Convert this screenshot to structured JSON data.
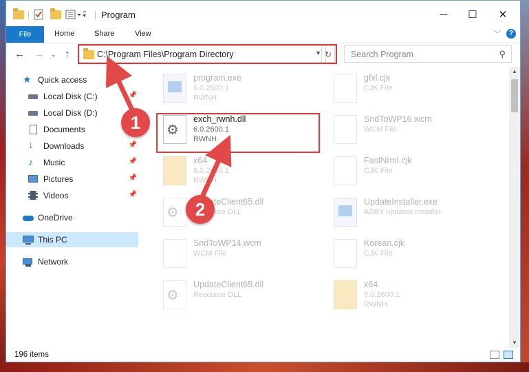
{
  "window": {
    "title": "Program",
    "controls": {
      "minimize": "─",
      "maximize": "☐",
      "close": "✕"
    }
  },
  "ribbon": {
    "file_tab": "File",
    "tabs": [
      "Home",
      "Share",
      "View"
    ],
    "help": "?"
  },
  "address_bar": {
    "path": "C:\\Program Files\\Program Directory",
    "search_placeholder": "Search Program"
  },
  "sidebar": {
    "items": [
      {
        "label": "Quick access",
        "icon": "star-icon",
        "pinned": false
      },
      {
        "label": "Local Disk (C:)",
        "icon": "drive-icon",
        "pinned": true
      },
      {
        "label": "Local Disk (D:)",
        "icon": "drive-icon",
        "pinned": true
      },
      {
        "label": "Documents",
        "icon": "documents-icon",
        "pinned": true
      },
      {
        "label": "Downloads",
        "icon": "download-icon",
        "pinned": true
      },
      {
        "label": "Music",
        "icon": "music-icon",
        "pinned": true
      },
      {
        "label": "Pictures",
        "icon": "pictures-icon",
        "pinned": true
      },
      {
        "label": "Videos",
        "icon": "videos-icon",
        "pinned": true
      },
      {
        "label": "OneDrive",
        "icon": "cloud-icon",
        "pinned": false
      },
      {
        "label": "This PC",
        "icon": "computer-icon",
        "pinned": false,
        "selected": true
      },
      {
        "label": "Network",
        "icon": "network-icon",
        "pinned": false
      }
    ]
  },
  "files": [
    {
      "name": "program.exe",
      "line1": "6.0.2600.1",
      "line2": "RWNH",
      "type": "exe",
      "faded": true
    },
    {
      "name": "gfxl.cjk",
      "line1": "CJK File",
      "line2": "",
      "type": "file",
      "faded": true
    },
    {
      "name": "exch_rwnh.dll",
      "line1": "6.0.2600.1",
      "line2": "RWNH",
      "type": "dll",
      "faded": false
    },
    {
      "name": "SndToWP16.wcm",
      "line1": "WCM File",
      "line2": "",
      "type": "file",
      "faded": true
    },
    {
      "name": "x64",
      "line1": "6.0.2600.1",
      "line2": "RWNH",
      "type": "folder",
      "faded": true
    },
    {
      "name": "FastNrml.cjk",
      "line1": "CJK File",
      "line2": "",
      "type": "file",
      "faded": true
    },
    {
      "name": "UpdateClient65.dll",
      "line1": "Resource DLL",
      "line2": "",
      "type": "dll",
      "faded": true
    },
    {
      "name": "UpdateInstaller.exe",
      "line1": "ABBY updates installer",
      "line2": "",
      "type": "exe",
      "faded": true
    },
    {
      "name": "SndToWP14.wcm",
      "line1": "WCM File",
      "line2": "",
      "type": "file",
      "faded": true
    },
    {
      "name": "Korean.cjk",
      "line1": "CJK File",
      "line2": "",
      "type": "file",
      "faded": true
    },
    {
      "name": "UpdateClient65.dll",
      "line1": "Resource DLL",
      "line2": "",
      "type": "dll",
      "faded": true
    },
    {
      "name": "x64",
      "line1": "6.0.2600.1",
      "line2": "RWNH",
      "type": "folder",
      "faded": true
    }
  ],
  "status_bar": {
    "item_count": "196 items"
  },
  "annotations": {
    "marker1": "1",
    "marker2": "2",
    "color": "#e03a3a"
  }
}
